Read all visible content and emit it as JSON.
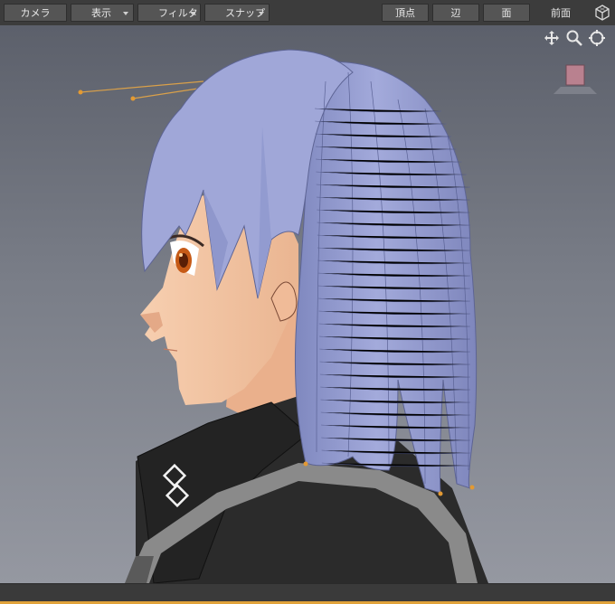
{
  "toolbar": {
    "camera_label": "カメラ",
    "display_label": "表示",
    "filter_label": "フィルタ",
    "snap_label": "スナップ",
    "vertex_label": "頂点",
    "edge_label": "辺",
    "face_label": "面",
    "view_label": "前面"
  },
  "icons": {
    "move": "move-icon",
    "zoom": "zoom-icon",
    "target": "target-icon",
    "cube": "cube-icon",
    "material": "material-swatch-icon"
  },
  "colors": {
    "viewport_top": "#5c606b",
    "viewport_bottom": "#9598a1",
    "hair": "#9aa2d6",
    "skin": "#f4c7a3",
    "jacket": "#2a2a2a",
    "accent": "#e0a23a"
  }
}
